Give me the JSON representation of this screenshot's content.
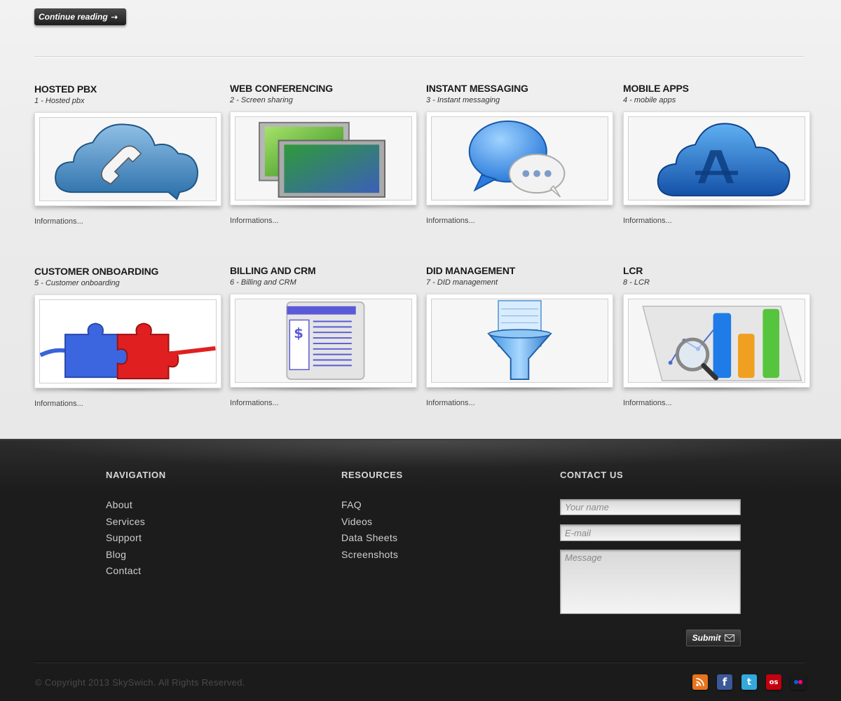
{
  "header": {
    "continue_label": "Continue reading"
  },
  "cards": [
    {
      "title": "HOSTED PBX",
      "subtitle": "1 - Hosted pbx",
      "info": "Informations...",
      "icon": "cloud-phone-icon"
    },
    {
      "title": "WEB CONFERENCING",
      "subtitle": "2 - Screen sharing",
      "info": "Informations...",
      "icon": "screens-icon"
    },
    {
      "title": "INSTANT MESSAGING",
      "subtitle": "3 - Instant messaging",
      "info": "Informations...",
      "icon": "chat-bubbles-icon"
    },
    {
      "title": "MOBILE APPS",
      "subtitle": "4 - mobile apps",
      "info": "Informations...",
      "icon": "cloud-appstore-icon"
    },
    {
      "title": "CUSTOMER ONBOARDING",
      "subtitle": "5 - Customer onboarding",
      "info": "Informations...",
      "icon": "puzzle-icon"
    },
    {
      "title": "BILLING AND CRM",
      "subtitle": "6 - Billing and CRM",
      "info": "Informations...",
      "icon": "invoice-icon"
    },
    {
      "title": "DID MANAGEMENT",
      "subtitle": "7 - DID management",
      "info": "Informations...",
      "icon": "funnel-report-icon"
    },
    {
      "title": "LCR",
      "subtitle": "8 - LCR",
      "info": "Informations...",
      "icon": "bar-chart-magnifier-icon"
    }
  ],
  "footer": {
    "navigation": {
      "heading": "NAVIGATION",
      "links": [
        "About",
        "Services",
        "Support",
        "Blog",
        "Contact"
      ]
    },
    "resources": {
      "heading": "RESOURCES",
      "links": [
        "FAQ",
        "Videos",
        "Data Sheets",
        "Screenshots"
      ]
    },
    "contact": {
      "heading": "CONTACT US",
      "name_placeholder": "Your name",
      "email_placeholder": "E-mail",
      "message_placeholder": "Message",
      "submit_label": "Submit"
    },
    "copyright": "© Copyright 2013 SkySwich. All Rights Reserved.",
    "social": [
      {
        "icon": "rss-icon",
        "color": "#e8731c"
      },
      {
        "icon": "facebook-icon",
        "color": "#3b5998"
      },
      {
        "icon": "twitter-icon",
        "color": "#33a9dc"
      },
      {
        "icon": "lastfm-icon",
        "color": "#c3000d"
      },
      {
        "icon": "flickr-icon",
        "color": "#1a1a1a"
      }
    ]
  }
}
